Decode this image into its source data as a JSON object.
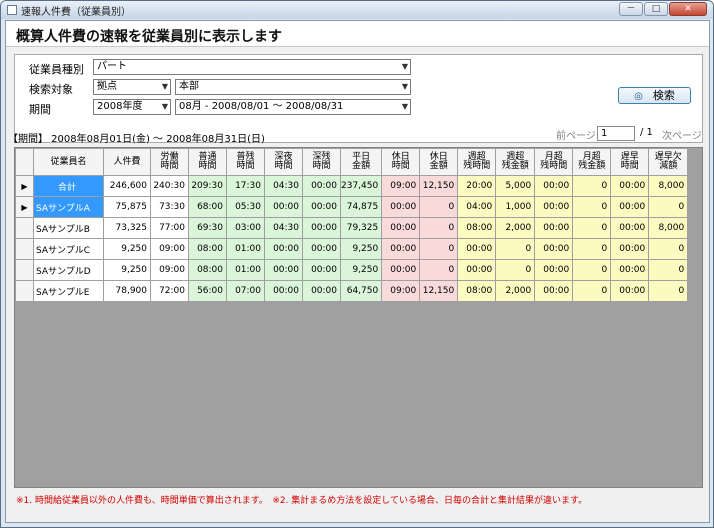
{
  "window": {
    "title": "速報人件費（従業員別）",
    "controls": [
      "－",
      "□",
      "✕"
    ]
  },
  "heading": "概算人件費の速報を従業員別に表示します",
  "filters": {
    "employee_type_label": "従業員種別",
    "employee_type_value": "パート",
    "search_target_label": "検索対象",
    "search_target_value": "拠点",
    "search_target_sub": "本部",
    "period_label": "期間",
    "period_year": "2008年度",
    "period_month": "08月 - 2008/08/01 ～ 2008/08/31",
    "search_button": "検索"
  },
  "period_display": "【期間】 2008年08月01日(金) ～ 2008年08月31日(日)",
  "pager": {
    "prev": "前ページ",
    "current": "1",
    "total": "/ 1",
    "next": "次ページ"
  },
  "table": {
    "headers": [
      "従業員名",
      "人件費",
      "労働\n時間",
      "普通\n時間",
      "普残\n時間",
      "深夜\n時間",
      "深残\n時間",
      "平日\n金額",
      "休日\n時間",
      "休日\n金額",
      "週超\n残時間",
      "週超\n残金額",
      "月超\n残時間",
      "月超\n残金額",
      "遅早\n時間",
      "遅早欠\n減額"
    ],
    "rows": [
      {
        "marker": "▶",
        "name": "合計",
        "cells": [
          "246,600",
          "240:30",
          "209:30",
          "17:30",
          "04:30",
          "00:00",
          "237,450",
          "09:00",
          "12,150",
          "20:00",
          "5,000",
          "00:00",
          "0",
          "00:00",
          "8,000"
        ]
      },
      {
        "marker": "▶",
        "name": "SAサンプルA",
        "cells": [
          "75,875",
          "73:30",
          "68:00",
          "05:30",
          "00:00",
          "00:00",
          "74,875",
          "00:00",
          "0",
          "04:00",
          "1,000",
          "00:00",
          "0",
          "00:00",
          "0"
        ]
      },
      {
        "marker": "",
        "name": "SAサンプルB",
        "cells": [
          "73,325",
          "77:00",
          "69:30",
          "03:00",
          "04:30",
          "00:00",
          "79,325",
          "00:00",
          "0",
          "08:00",
          "2,000",
          "00:00",
          "0",
          "00:00",
          "8,000"
        ]
      },
      {
        "marker": "",
        "name": "SAサンプルC",
        "cells": [
          "9,250",
          "09:00",
          "08:00",
          "01:00",
          "00:00",
          "00:00",
          "9,250",
          "00:00",
          "0",
          "00:00",
          "0",
          "00:00",
          "0",
          "00:00",
          "0"
        ]
      },
      {
        "marker": "",
        "name": "SAサンプルD",
        "cells": [
          "9,250",
          "09:00",
          "08:00",
          "01:00",
          "00:00",
          "00:00",
          "9,250",
          "00:00",
          "0",
          "00:00",
          "0",
          "00:00",
          "0",
          "00:00",
          "0"
        ]
      },
      {
        "marker": "",
        "name": "SAサンプルE",
        "cells": [
          "78,900",
          "72:00",
          "56:00",
          "07:00",
          "00:00",
          "00:00",
          "64,750",
          "09:00",
          "12,150",
          "08:00",
          "2,000",
          "00:00",
          "0",
          "00:00",
          "0"
        ]
      }
    ]
  },
  "footnote": "※1. 時間給従業員以外の人件費も、時間単価で算出されます。　※2. 集計まるめ方法を設定している場合、日毎の合計と集計結果が違います。",
  "colors": {
    "selected": "#3399ff",
    "green": "#daf5d9",
    "pink": "#f9dada",
    "yellow": "#fbfbc1",
    "footnote": "#d40000"
  }
}
